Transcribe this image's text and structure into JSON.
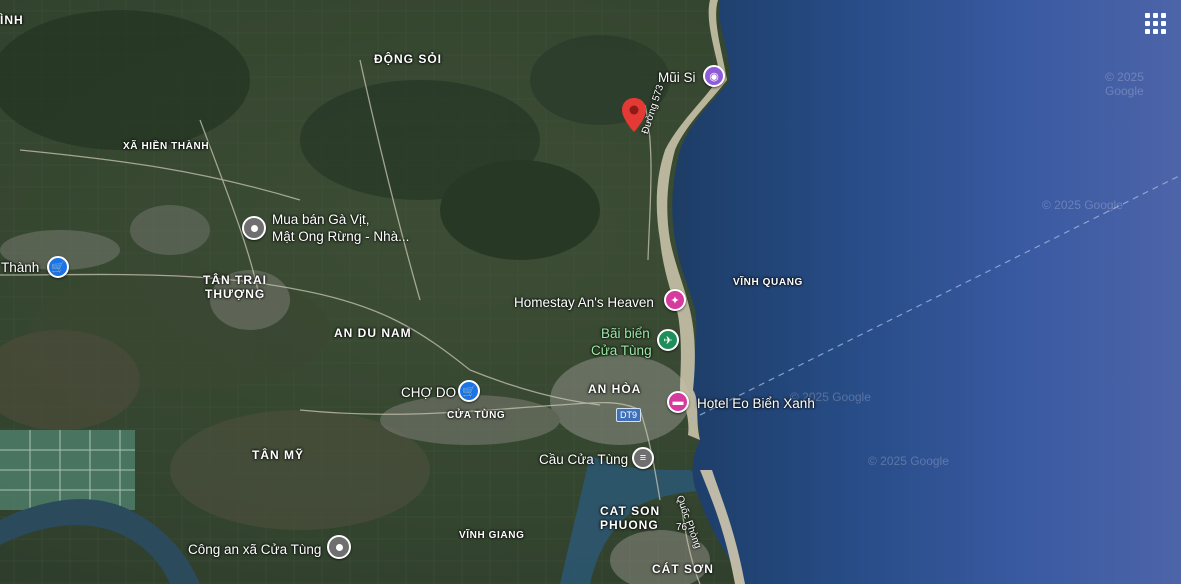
{
  "area_labels": {
    "vinh": "ÌNH",
    "dong_soi": "ĐỘNG SỎI",
    "xa_hien_thanh": "XÃ HIỀN THÀNH",
    "tan_trai_thuong_1": "TÂN TRAI",
    "tan_trai_thuong_2": "THƯỢNG",
    "an_du_nam": "AN DU NAM",
    "vinh_quang": "VĨNH QUANG",
    "an_hoa": "AN HÒA",
    "cua_tung": "CỬA TÙNG",
    "tan_my": "TÂN MỸ",
    "cat_son_phuong_1": "CAT SON",
    "cat_son_phuong_2": "PHUONG",
    "vinh_giang": "VĨNH GIANG",
    "cat_son": "CÁT SƠN"
  },
  "road_labels": {
    "duong_573": "Đường 573",
    "quoc_phong": "Quốc Phòng",
    "route_76": "76",
    "dt9": "DT9"
  },
  "pois": {
    "mui_si": {
      "name": "Mũi Si",
      "icon": "camera-icon",
      "color": "#8e5cd9"
    },
    "mua_ban_line1": "Mua bán Gà Vịt,",
    "mua_ban_line2": "Mật Ong Rừng - Nhà...",
    "thanh": {
      "name": "Thành",
      "icon": "shopping-cart-icon",
      "color": "#1a73e8"
    },
    "homestay": {
      "name": "Homestay An's Heaven",
      "icon": "hotel-icon",
      "color": "#d63a9e"
    },
    "bai_bien_line1": "Bãi biển",
    "bai_bien_line2": "Cửa Tùng",
    "cho_do": {
      "name": "CHỢ DO",
      "icon": "shopping-cart-icon",
      "color": "#1a73e8"
    },
    "hotel_eo": {
      "name": "Hotel Eo Biển Xanh",
      "icon": "bed-icon",
      "color": "#d63a9e"
    },
    "cau_cua_tung": {
      "name": "Cầu Cửa Tùng",
      "icon": "bridge-icon",
      "color": "#6f6f6f"
    },
    "cong_an": {
      "name": "Công an xã Cửa Tùng",
      "icon": "place-pin-icon",
      "color": "#6f6f6f"
    }
  },
  "watermarks": [
    "© 2025 Google",
    "© 2025 Google",
    "© 2025 Google",
    "© 2025 Google"
  ],
  "marker": {
    "icon": "red-location-marker-icon",
    "color": "#e53935"
  },
  "controls": {
    "apps_icon": "apps-grid-icon"
  }
}
